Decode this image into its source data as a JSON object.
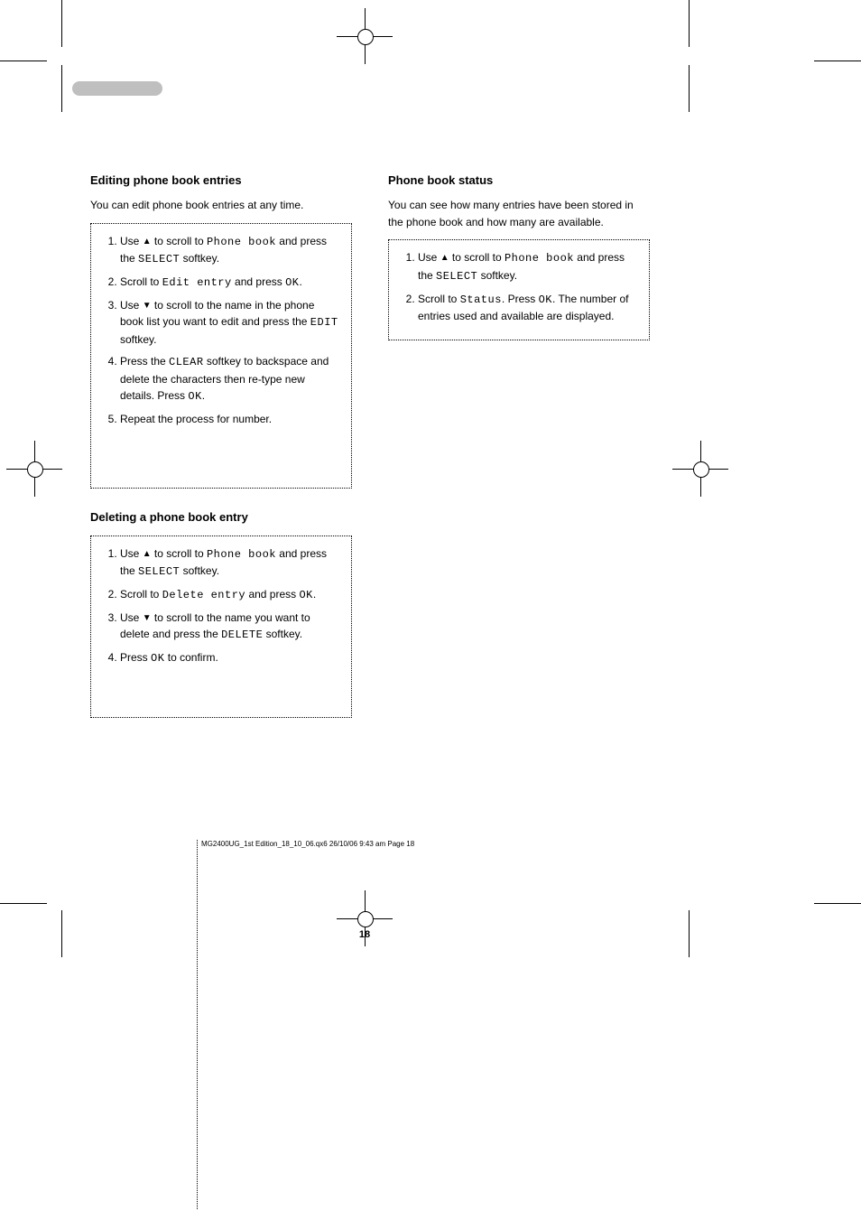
{
  "header": {
    "tab_label": ""
  },
  "left": {
    "h_edit": "Editing phone book entries",
    "edit_intro": "You can edit phone book entries at any time.",
    "edit_steps": [
      "Use ▲ to scroll to Phone book and press the SELECT softkey.",
      "Scroll to Edit entry and press OK.",
      "Use ▼ to scroll to the name in the phone book list you want to edit and press the EDIT softkey.",
      "Press the CLEAR softkey to backspace and delete the characters then re-type new details. Press OK.",
      "Repeat the process for number."
    ],
    "h_delete": "Deleting a phone book entry",
    "delete_steps": [
      "Use ▲ to scroll to Phone book and press the SELECT softkey.",
      "Scroll to Delete entry and press OK.",
      "Use ▼ to scroll to the name you want to delete and press the DELETE softkey.",
      "Press OK to confirm."
    ]
  },
  "right": {
    "h_status": "Phone book status",
    "status_intro": "You can see how many entries have been stored in the phone book and how many are available.",
    "status_steps": [
      "Use ▲ to scroll to Phone book and press the SELECT softkey.",
      "Scroll to Status. Press OK. The number of entries used and available are displayed."
    ]
  },
  "mono": {
    "phone_book": "Phone book",
    "select": "SELECT",
    "edit_entry": "Edit entry",
    "delete_entry": "Delete entry",
    "status": "Status",
    "ok": "OK",
    "edit": "EDIT",
    "clear": "CLEAR",
    "delete": "DELETE"
  },
  "page_number": "18",
  "footer_file": "MG2400UG_1st Edition_18_10_06.qx6  26/10/06  9:43 am  Page 18"
}
